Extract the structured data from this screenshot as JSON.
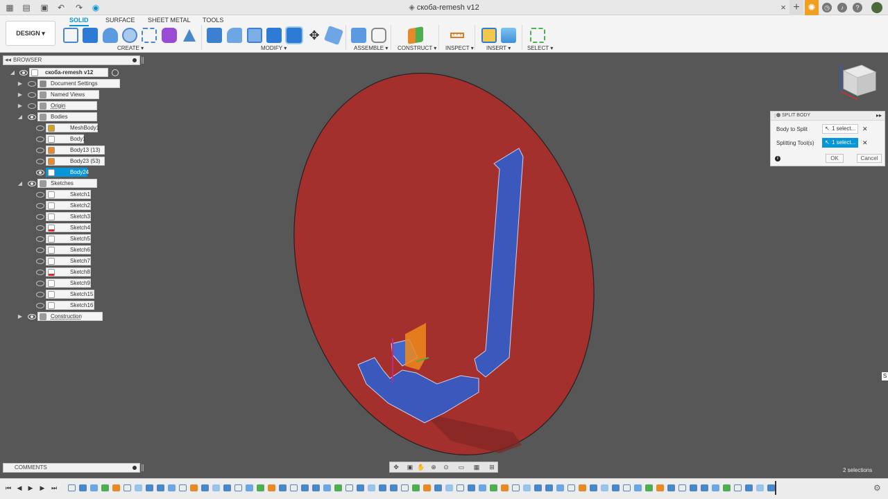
{
  "window": {
    "title": "скоба-remesh v12",
    "close_glyph": "×",
    "new_tab_glyph": "+"
  },
  "toolbar": {
    "workspace": "DESIGN ▾",
    "tabs": [
      "SOLID",
      "SURFACE",
      "SHEET METAL",
      "TOOLS"
    ],
    "active_tab": "SOLID",
    "groups": [
      "CREATE ▾",
      "MODIFY ▾",
      "ASSEMBLE ▾",
      "CONSTRUCT ▾",
      "INSPECT ▾",
      "INSERT ▾",
      "SELECT ▾"
    ]
  },
  "browser": {
    "title": "BROWSER",
    "tree": [
      {
        "label": "скоба-remesh v12",
        "level": 0,
        "expanded": true,
        "visible": true,
        "kind": "document"
      },
      {
        "label": "Document Settings",
        "level": 1,
        "expanded": false,
        "kind": "settings"
      },
      {
        "label": "Named Views",
        "level": 1,
        "expanded": false,
        "kind": "folder"
      },
      {
        "label": "Origin",
        "level": 1,
        "expanded": false,
        "visible": false,
        "kind": "folder",
        "dimmed": true
      },
      {
        "label": "Bodies",
        "level": 1,
        "expanded": true,
        "visible": true,
        "kind": "folder"
      },
      {
        "label": "MeshBody1",
        "level": 2,
        "visible": false,
        "kind": "mesh-body"
      },
      {
        "label": "Body1",
        "level": 2,
        "visible": false,
        "kind": "body"
      },
      {
        "label": "Body13 (13)",
        "level": 2,
        "visible": false,
        "kind": "body-orange"
      },
      {
        "label": "Body23 (53)",
        "level": 2,
        "visible": false,
        "kind": "body-orange"
      },
      {
        "label": "Body24",
        "level": 2,
        "visible": true,
        "kind": "body",
        "selected": true
      },
      {
        "label": "Sketches",
        "level": 1,
        "expanded": true,
        "visible": true,
        "kind": "folder"
      },
      {
        "label": "Sketch1",
        "level": 2,
        "kind": "sketch"
      },
      {
        "label": "Sketch2",
        "level": 2,
        "kind": "sketch"
      },
      {
        "label": "Sketch3",
        "level": 2,
        "kind": "sketch"
      },
      {
        "label": "Sketch4",
        "level": 2,
        "kind": "sketch-warning"
      },
      {
        "label": "Sketch5",
        "level": 2,
        "kind": "sketch"
      },
      {
        "label": "Sketch6",
        "level": 2,
        "kind": "sketch"
      },
      {
        "label": "Sketch7",
        "level": 2,
        "kind": "sketch"
      },
      {
        "label": "Sketch8",
        "level": 2,
        "kind": "sketch-warning"
      },
      {
        "label": "Sketch9",
        "level": 2,
        "kind": "sketch"
      },
      {
        "label": "Sketch15",
        "level": 2,
        "kind": "sketch"
      },
      {
        "label": "Sketch16",
        "level": 2,
        "kind": "sketch"
      },
      {
        "label": "Construction",
        "level": 1,
        "expanded": false,
        "visible": true,
        "kind": "folder",
        "dimmed": true
      }
    ]
  },
  "dialog": {
    "title": "SPLIT BODY",
    "body_to_split_label": "Body to Split",
    "body_to_split_value": "1 select...",
    "splitting_tools_label": "Splitting Tool(s)",
    "splitting_tools_value": "1 select...",
    "clear_glyph": "✕",
    "info_glyph": "i",
    "ok": "OK",
    "cancel": "Cancel"
  },
  "comments": {
    "title": "COMMENTS"
  },
  "status": {
    "selections": "2 selections",
    "side_tab": "S"
  },
  "colors": {
    "accent": "#0696d7",
    "viewport": "#575757",
    "plane": "#a3302c",
    "body": "#2d5fd1",
    "sketch_orange": "#f08a1c"
  }
}
